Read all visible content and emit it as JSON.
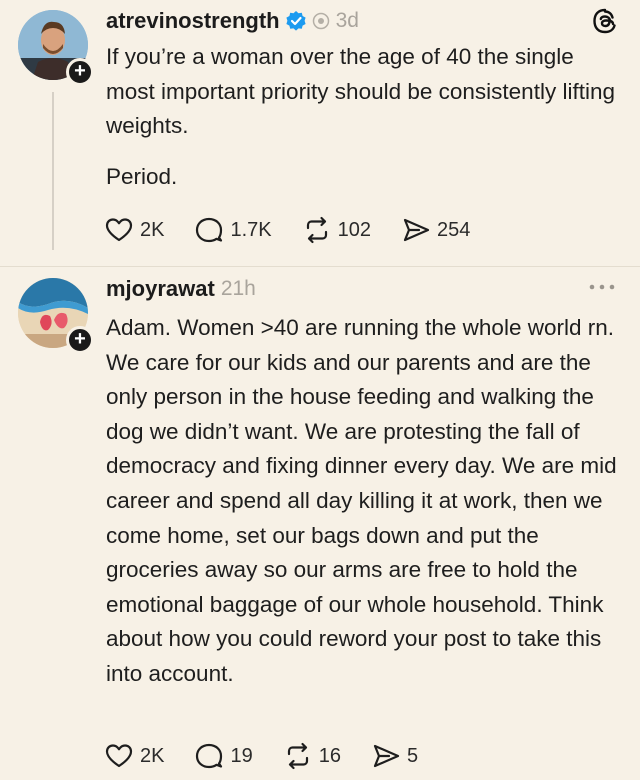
{
  "posts": [
    {
      "username": "atrevinostrength",
      "verified": true,
      "timestamp": "3d",
      "paragraphs": [
        "If you’re a woman over the age of 40 the single most important priority should be consistently lifting weights.",
        "Period."
      ],
      "actions": {
        "likes": "2K",
        "replies": "1.7K",
        "reposts": "102",
        "shares": "254"
      }
    },
    {
      "username": "mjoyrawat",
      "timestamp": "21h",
      "paragraphs": [
        "Adam. Women >40 are running the whole world rn. We care for our kids and our parents and are the only person in the house feeding and walking the dog we didn’t want. We are protesting the fall of democracy and fixing dinner every day. We are mid career and spend all day killing it at work, then we come home, set our bags down and put the groceries away so our arms are free to hold the emotional baggage of our whole household. Think about how you could reword your post to take this into account."
      ],
      "actions": {
        "likes": "2K",
        "replies": "19",
        "reposts": "16",
        "shares": "5"
      }
    }
  ],
  "icons": {
    "app_logo": "threads-logo-icon",
    "verified": "verified-badge-icon",
    "like": "heart-icon",
    "reply": "speech-bubble-icon",
    "repost": "repost-arrows-icon",
    "share": "paper-plane-icon",
    "more": "more-dots-icon",
    "follow": "plus-icon"
  },
  "colors": {
    "background": "#f7f1e6",
    "verified": "#1d9bf0",
    "muted": "#a9a49c"
  }
}
